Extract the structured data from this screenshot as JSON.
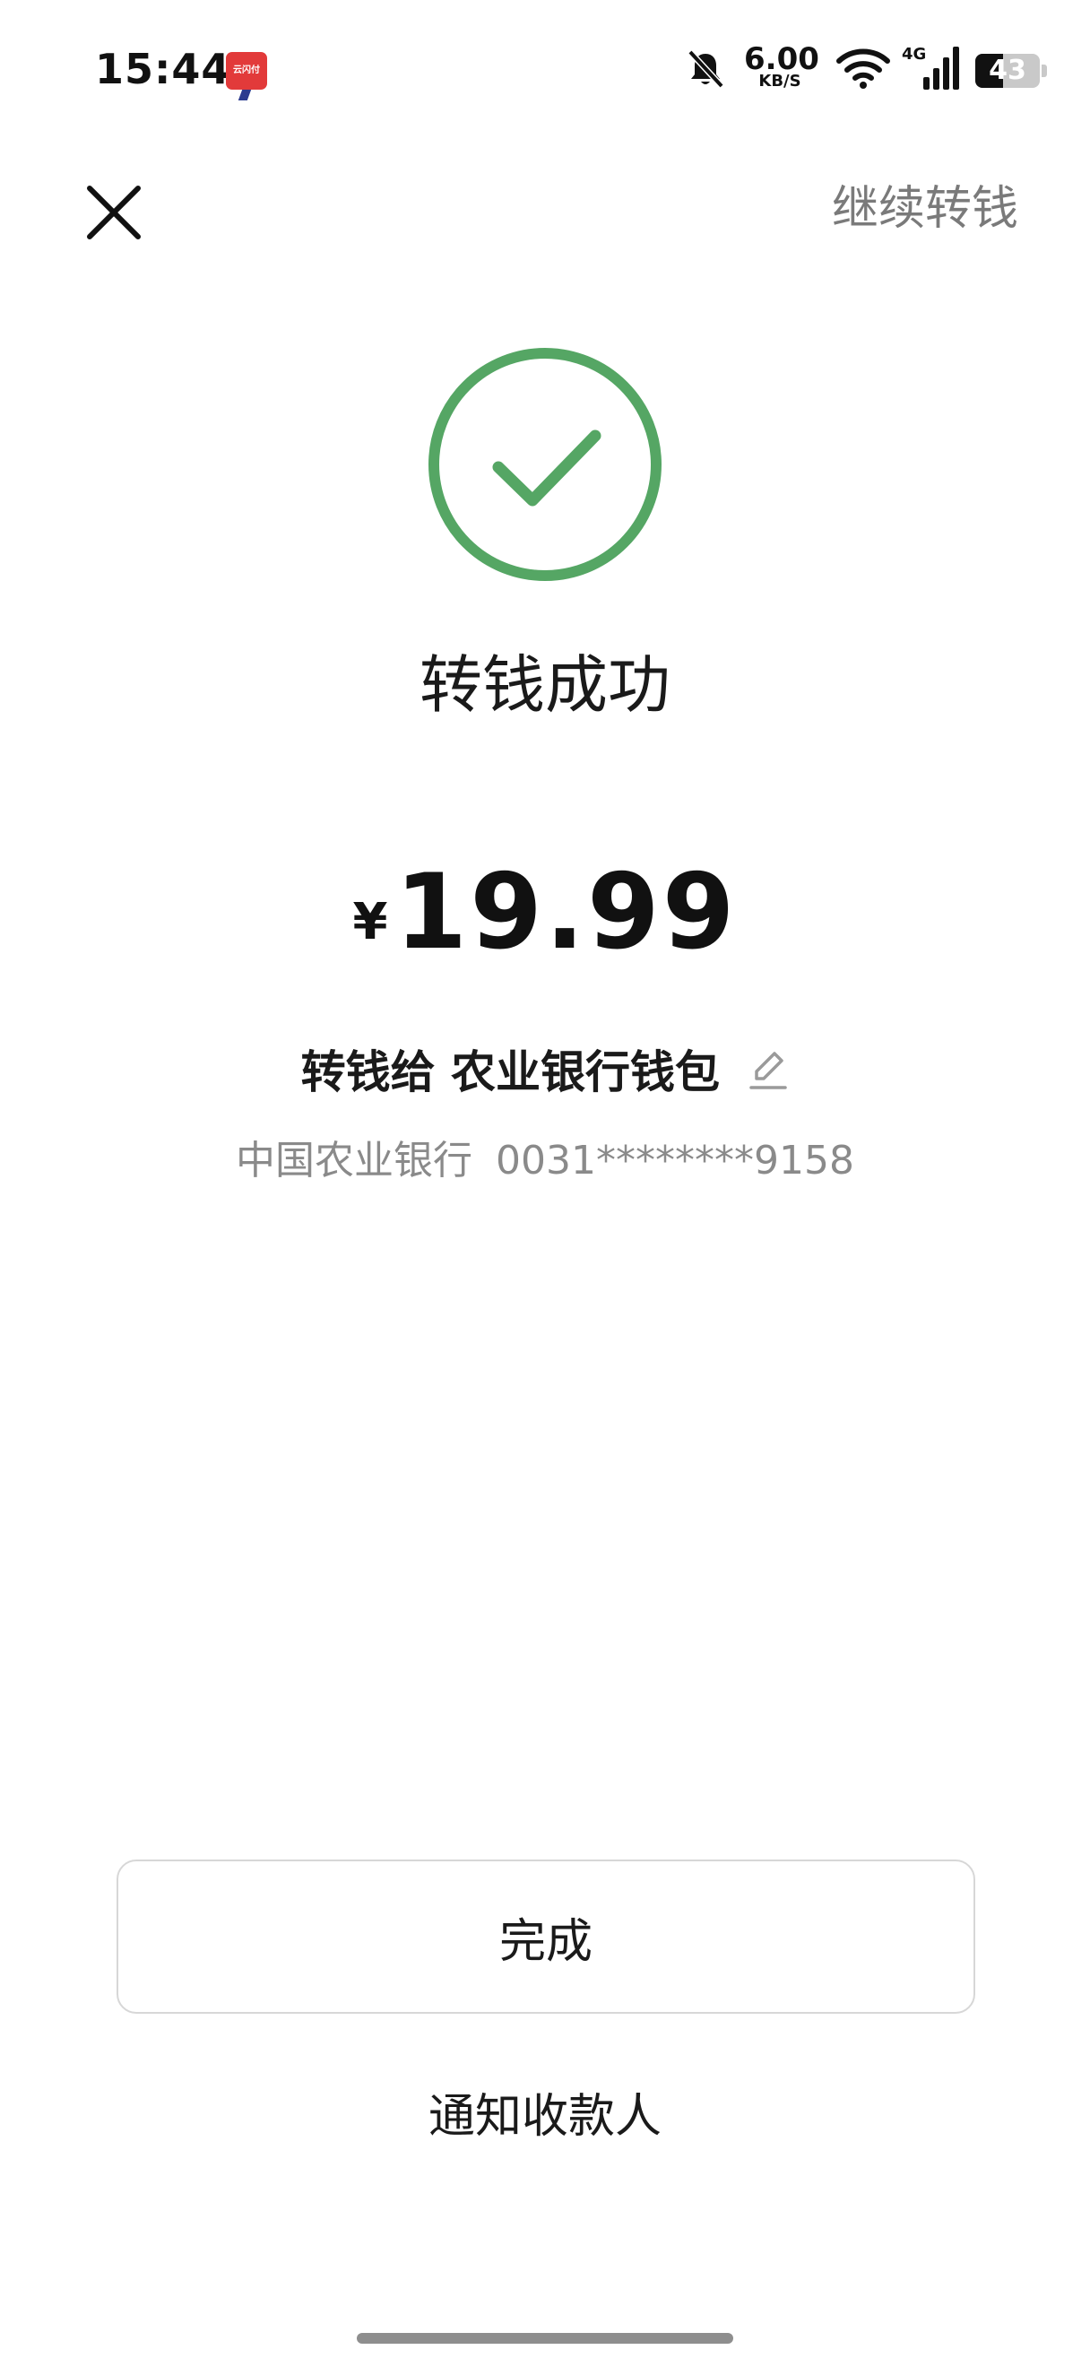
{
  "status_bar": {
    "time": "15:44",
    "app_notification_label": "云闪付",
    "network_speed_value": "6.00",
    "network_speed_unit": "KB/S",
    "network_type": "4G",
    "battery_level": "43",
    "battery_fraction": 0.43
  },
  "nav": {
    "continue_label": "继续转钱"
  },
  "result": {
    "title": "转钱成功",
    "currency_symbol": "¥",
    "amount": "19.99",
    "recipient_prefix": "转钱给",
    "recipient_name": "农业银行钱包",
    "bank_name": "中国农业银行",
    "card_number": "0031********9158"
  },
  "actions": {
    "done_label": "完成",
    "notify_label": "通知收款人"
  },
  "colors": {
    "success_green": "#55a664",
    "secondary_text": "#8a8a8a"
  }
}
